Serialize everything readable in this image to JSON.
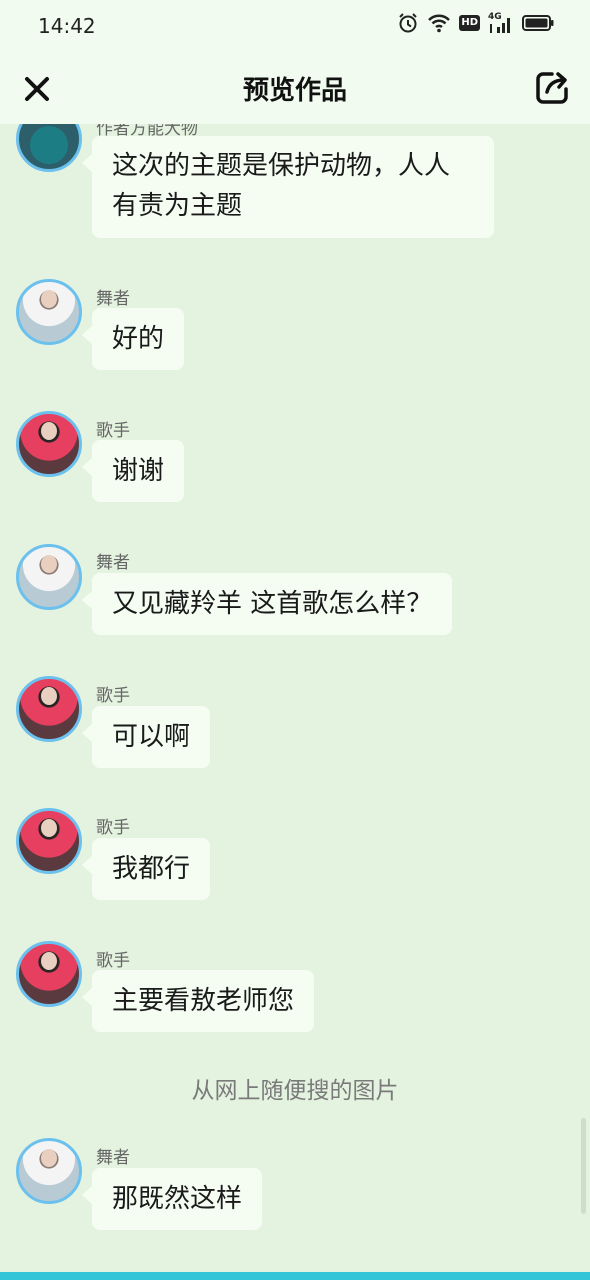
{
  "status": {
    "time": "14:42",
    "icons": [
      "alarm-icon",
      "wifi-icon",
      "hd-icon",
      "4g-signal-icon",
      "battery-icon"
    ],
    "hd_label": "HD",
    "network_label": "4G"
  },
  "header": {
    "title": "预览作品",
    "close_icon": "close-icon",
    "share_icon": "share-icon"
  },
  "messages": [
    {
      "sender": "作者方能大物",
      "avatar": "author",
      "text_lines": [
        "这次的主题是保护动物，人人",
        "有责为主题"
      ]
    },
    {
      "sender": "舞者",
      "avatar": "dancer",
      "text": "好的"
    },
    {
      "sender": "歌手",
      "avatar": "singer",
      "text": "谢谢"
    },
    {
      "sender": "舞者",
      "avatar": "dancer",
      "text": "又见藏羚羊 这首歌怎么样？"
    },
    {
      "sender": "歌手",
      "avatar": "singer",
      "text": "可以啊"
    },
    {
      "sender": "歌手",
      "avatar": "singer",
      "text": "我都行"
    },
    {
      "sender": "歌手",
      "avatar": "singer",
      "text": "主要看敖老师您"
    },
    {
      "sender": "舞者",
      "avatar": "dancer",
      "text": "那既然这样"
    }
  ],
  "system_note": "从网上随便搜的图片",
  "colors": {
    "background": "#e4f3df",
    "header": "#f1fbf0",
    "bubble": "#f5fdf3",
    "avatar_border": "#6cc0ee",
    "bottom_bar": "#34c6d8"
  }
}
